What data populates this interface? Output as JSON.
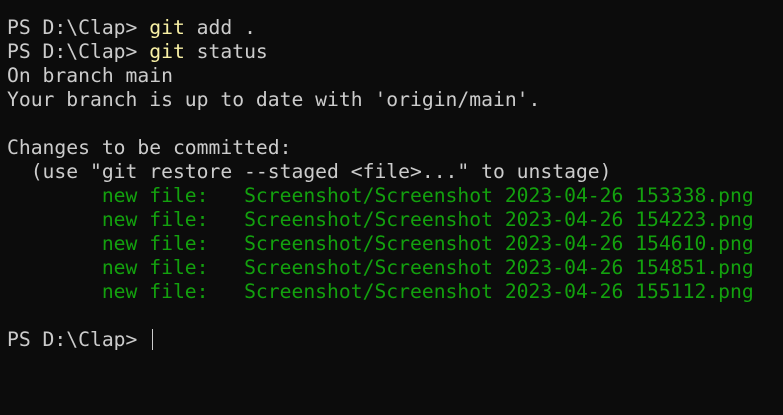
{
  "terminal": {
    "line1": {
      "prompt": "PS D:\\Clap> ",
      "command": "git",
      "args": " add ."
    },
    "line2": {
      "prompt": "PS D:\\Clap> ",
      "command": "git",
      "args": " status"
    },
    "branch_line": "On branch main",
    "uptodate_line": "Your branch is up to date with 'origin/main'.",
    "changes_header": "Changes to be committed:",
    "hint_line": "  (use \"git restore --staged <file>...\" to unstage)",
    "staged_files": [
      {
        "status": "        new file:   ",
        "path": "Screenshot/Screenshot 2023-04-26 153338.png"
      },
      {
        "status": "        new file:   ",
        "path": "Screenshot/Screenshot 2023-04-26 154223.png"
      },
      {
        "status": "        new file:   ",
        "path": "Screenshot/Screenshot 2023-04-26 154610.png"
      },
      {
        "status": "        new file:   ",
        "path": "Screenshot/Screenshot 2023-04-26 154851.png"
      },
      {
        "status": "        new file:   ",
        "path": "Screenshot/Screenshot 2023-04-26 155112.png"
      }
    ],
    "final_prompt": "PS D:\\Clap> "
  },
  "colors": {
    "background": "#0c0c0c",
    "text": "#cccccc",
    "command": "#f9f1a5",
    "staged": "#13a10e"
  }
}
